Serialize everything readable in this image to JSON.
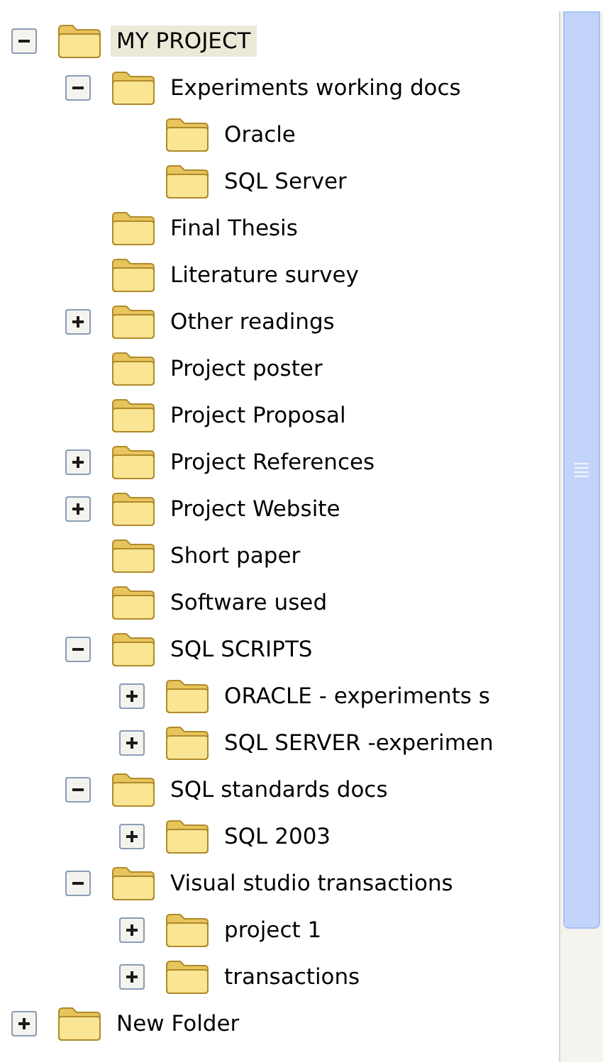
{
  "tree": {
    "items": [
      {
        "label": "MY PROJECT",
        "selected": true,
        "expanded": true,
        "children": [
          {
            "label": "Experiments working docs",
            "selected": false,
            "expanded": true,
            "children": [
              {
                "label": "Oracle",
                "selected": false
              },
              {
                "label": "SQL Server",
                "selected": false
              }
            ]
          },
          {
            "label": "Final Thesis",
            "selected": false
          },
          {
            "label": "Literature survey",
            "selected": false
          },
          {
            "label": "Other readings",
            "selected": false,
            "expanded": false
          },
          {
            "label": "Project poster",
            "selected": false
          },
          {
            "label": "Project Proposal",
            "selected": false
          },
          {
            "label": "Project References",
            "selected": false,
            "expanded": false
          },
          {
            "label": "Project Website",
            "selected": false,
            "expanded": false
          },
          {
            "label": "Short paper",
            "selected": false
          },
          {
            "label": "Software used",
            "selected": false
          },
          {
            "label": "SQL SCRIPTS",
            "selected": false,
            "expanded": true,
            "children": [
              {
                "label": "ORACLE - experiments s",
                "selected": false,
                "expanded": false
              },
              {
                "label": "SQL SERVER -experimen",
                "selected": false,
                "expanded": false
              }
            ]
          },
          {
            "label": "SQL standards docs",
            "selected": false,
            "expanded": true,
            "children": [
              {
                "label": "SQL 2003",
                "selected": false,
                "expanded": false
              }
            ]
          },
          {
            "label": "Visual studio transactions",
            "selected": false,
            "expanded": true,
            "children": [
              {
                "label": "project 1",
                "selected": false,
                "expanded": false
              },
              {
                "label": "transactions",
                "selected": false,
                "expanded": false
              }
            ]
          }
        ]
      },
      {
        "label": "New Folder",
        "selected": false,
        "expanded": false
      }
    ]
  }
}
